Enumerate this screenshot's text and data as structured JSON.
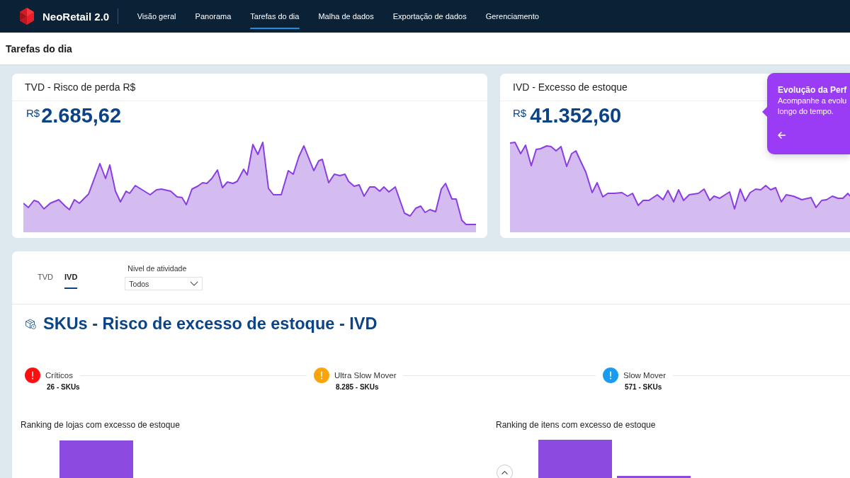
{
  "app": {
    "name": "NeoRetail 2.0"
  },
  "nav": [
    {
      "label": "Visão geral",
      "selected": false
    },
    {
      "label": "Panorama",
      "selected": false
    },
    {
      "label": "Tarefas do dia",
      "selected": true
    },
    {
      "label": "Malha de dados",
      "selected": false
    },
    {
      "label": "Exportação de dados",
      "selected": false
    },
    {
      "label": "Gerenciamento",
      "selected": false
    }
  ],
  "page_title": "Tarefas do dia",
  "kpi_cards": [
    {
      "title": "TVD - Risco de perda R$",
      "currency": "R$",
      "value": "2.685,62"
    },
    {
      "title": "IVD - Excesso de estoque",
      "currency": "R$",
      "value": "41.352,60"
    }
  ],
  "tooltip": {
    "title": "Evolução da Perf",
    "lines": [
      "Acompanhe a evolu",
      "longo do tempo."
    ]
  },
  "panel": {
    "tabs": [
      {
        "label": "TVD",
        "selected": false
      },
      {
        "label": "IVD",
        "selected": true
      }
    ],
    "filter": {
      "label": "Nivel de atividade",
      "value": "Todos"
    },
    "heading": "SKUs - Risco de excesso de estoque - IVD",
    "statuses": [
      {
        "label": "Críticos",
        "count": "26 - SKUs",
        "color": "#fe0e0e"
      },
      {
        "label": "Ultra Slow Mover",
        "count": "8.285 - SKUs",
        "color": "#fba40a"
      },
      {
        "label": "Slow Mover",
        "count": "571 - SKUs",
        "color": "#1a9bf0"
      }
    ],
    "rankings": [
      {
        "title": "Ranking de lojas com excesso de estoque",
        "scroll_up_button": false
      },
      {
        "title": "Ranking de itens com excesso de estoque",
        "scroll_up_button": true
      }
    ]
  }
}
